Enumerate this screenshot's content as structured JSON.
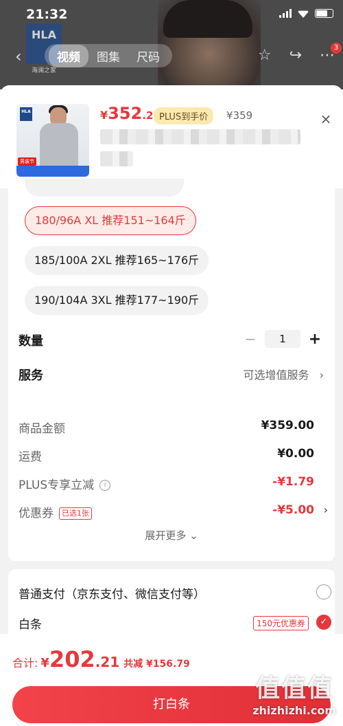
{
  "status_bar": {
    "time": "21:32"
  },
  "background": {
    "brand_logo": "HLA",
    "brand_sub": "海澜之家",
    "tabs": [
      "视频",
      "图集",
      "尺码"
    ],
    "active_tab": "视频",
    "cart_badge": "3"
  },
  "header": {
    "price_symbol": "¥",
    "price_int": "352",
    "price_dec": ".21",
    "plus_badge": "PLUS到手价",
    "original_price": "¥359",
    "thumb_logo": "HLA",
    "thumb_tag": "男装节"
  },
  "sizes": [
    {
      "label": "180/96A XL 推荐151~164斤",
      "selected": true
    },
    {
      "label": "185/100A 2XL 推荐165~176斤",
      "selected": false
    },
    {
      "label": "190/104A 3XL 推荐177~190斤",
      "selected": false
    }
  ],
  "quantity": {
    "label": "数量",
    "minus": "−",
    "value": "1",
    "plus": "+"
  },
  "service": {
    "label": "服务",
    "hint": "可选增值服务",
    "chevron": "›"
  },
  "fees": {
    "goods_label": "商品金额",
    "goods_value": "¥359.00",
    "shipping_label": "运费",
    "shipping_value": "¥0.00",
    "plus_label": "PLUS专享立减",
    "plus_value": "-¥1.79",
    "coupon_label": "优惠券",
    "coupon_tag": "已选1张",
    "coupon_value": "-¥5.00",
    "expand": "展开更多 ⌄"
  },
  "payment": {
    "normal_label": "普通支付（京东支付、微信支付等）",
    "baitiao_label": "白条",
    "baitiao_coupon": "150元优惠券",
    "check": "✓"
  },
  "bottom": {
    "total_label": "合计:",
    "total_symbol": "¥",
    "total_int": "202",
    "total_dec": ".21",
    "total_saving": "共减 ¥156.79",
    "pay_button": "打白条"
  },
  "watermark": {
    "text": "值值值",
    "url": "zhizhizhi.com"
  },
  "colors": {
    "accent": "#e4393c",
    "plus_bg": "#fbeab0"
  },
  "icons": {
    "close": "×",
    "back": "‹",
    "info": "i"
  }
}
